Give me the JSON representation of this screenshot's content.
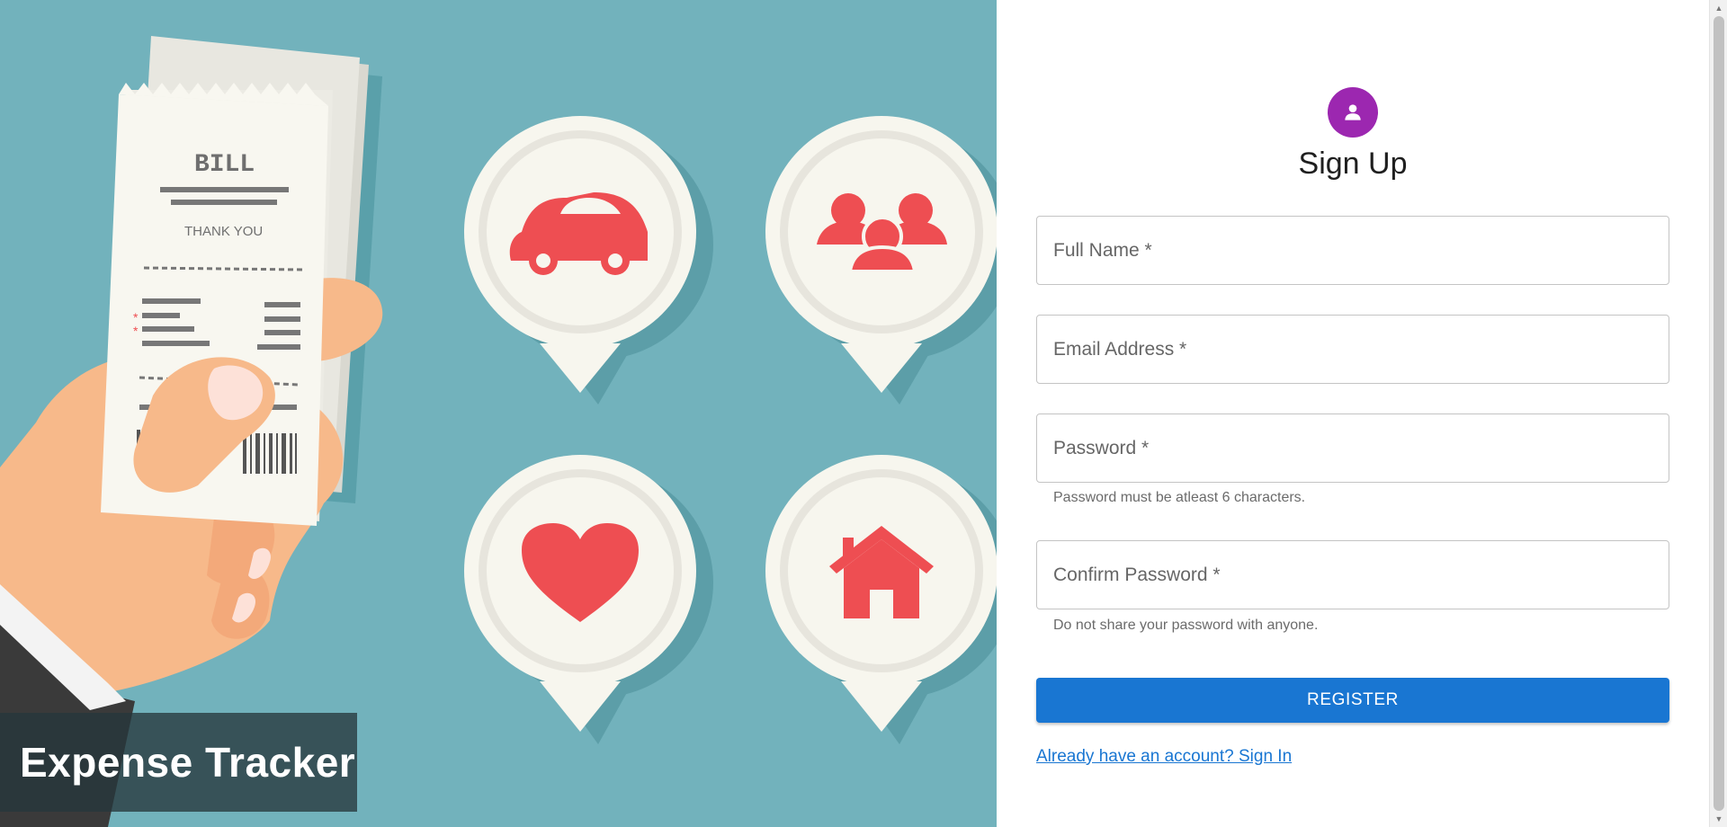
{
  "hero": {
    "brand_title": "Expense Tracker",
    "receipt": {
      "title": "BILL",
      "subtitle": "THANK YOU"
    },
    "icons": [
      "car-icon",
      "people-icon",
      "heart-icon",
      "home-icon"
    ],
    "colors": {
      "background": "#72b2bc",
      "pin_fill": "#f7f6ee",
      "icon_red": "#ee4e52"
    }
  },
  "form": {
    "avatar_icon": "person-icon",
    "avatar_color": "#9c27b0",
    "title": "Sign Up",
    "fields": {
      "full_name": {
        "label": "Full Name *"
      },
      "email": {
        "label": "Email Address *"
      },
      "password": {
        "label": "Password *",
        "helper": "Password must be atleast 6 characters."
      },
      "confirm_password": {
        "label": "Confirm Password *",
        "helper": "Do not share your password with anyone."
      }
    },
    "register_label": "Register",
    "signin_link": "Already have an account? Sign In",
    "accent_color": "#1976d2"
  }
}
